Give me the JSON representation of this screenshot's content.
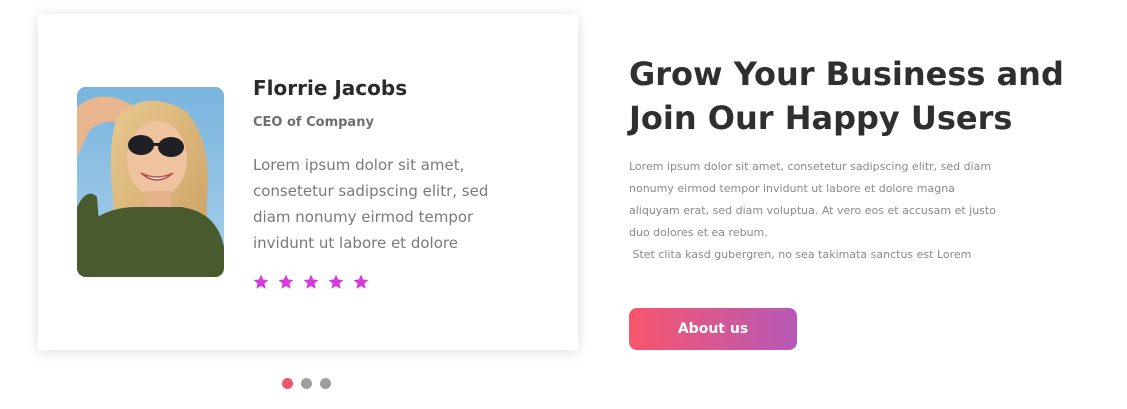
{
  "testimonial": {
    "name": "Florrie Jacobs",
    "role": "CEO of Company",
    "quote_lines": [
      "Lorem ipsum dolor sit amet,",
      "consetetur sadipscing elitr, sed",
      "diam nonumy eirmod tempor",
      "invidunt ut labore et dolore"
    ],
    "rating": 5,
    "rating_max": 5,
    "star_color": "#d63adf",
    "avatar_icon": "woman-portrait-photo"
  },
  "carousel": {
    "slide_count": 3,
    "active_index": 0,
    "active_color": "#f0566a",
    "inactive_color": "#9e9e9e"
  },
  "hero": {
    "headline_lines": [
      "Grow Your Business and",
      "Join Our Happy Users"
    ],
    "body_lines": [
      "Lorem ipsum dolor sit amet, consetetur sadipscing elitr, sed diam",
      "nonumy eirmod tempor invidunt ut labore et dolore magna",
      "aliquyam erat, sed diam voluptua. At vero eos et accusam et justo",
      "duo dolores et ea rebum.",
      " Stet clita kasd gubergren, no sea takimata sanctus est Lorem"
    ],
    "button_label": "About us",
    "button_gradient": [
      "#f7566b",
      "#b659b7"
    ]
  }
}
